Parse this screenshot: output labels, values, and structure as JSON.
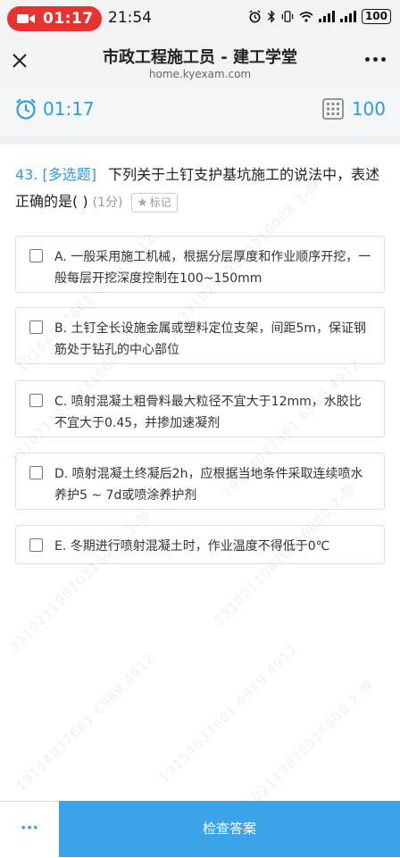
{
  "status_bar": {
    "record_time": "01:17",
    "clock": "21:54",
    "signal_left": "ıl",
    "signal_right": "ıl",
    "battery": "100"
  },
  "nav": {
    "title": "市政工程施工员 - 建工学堂",
    "url": "home.kyexam.com"
  },
  "timer_bar": {
    "elapsed": "01:17",
    "total_questions": "100"
  },
  "question": {
    "number": "43.",
    "type": "[多选题]",
    "stem": "下列关于土钉支护基坑施工的说法中，表述正确的是( )",
    "score": "(1分)",
    "mark_label": "标记"
  },
  "options": [
    {
      "text": "A. 一般采用施工机械，根据分层厚度和作业顺序开挖，一般每层开挖深度控制在100~150mm"
    },
    {
      "text": "B. 土钉全长设施金属或塑料定位支架，间距5m，保证钢筋处于钻孔的中心部位"
    },
    {
      "text": "C. 喷射混凝土粗骨料最大粒径不宜大于12mm，水胶比不宜大于0.45，并掺加速凝剂"
    },
    {
      "text": "D. 喷射混凝土终凝后2h，应根据当地条件采取连续喷水养护5 ~ 7d或喷涂养护剂"
    },
    {
      "text": "E. 冬期进行喷射混凝土时，作业温度不得低于0℃"
    }
  ],
  "watermark": {
    "texts": [
      "19154037661 6989 4912",
      "33102119870316008 2-静"
    ]
  },
  "bottom_bar": {
    "more_label": "···",
    "check_label": "检查答案"
  },
  "colors": {
    "accent": "#2e9be4",
    "button": "#3ba4e8",
    "record": "#e8322f"
  }
}
